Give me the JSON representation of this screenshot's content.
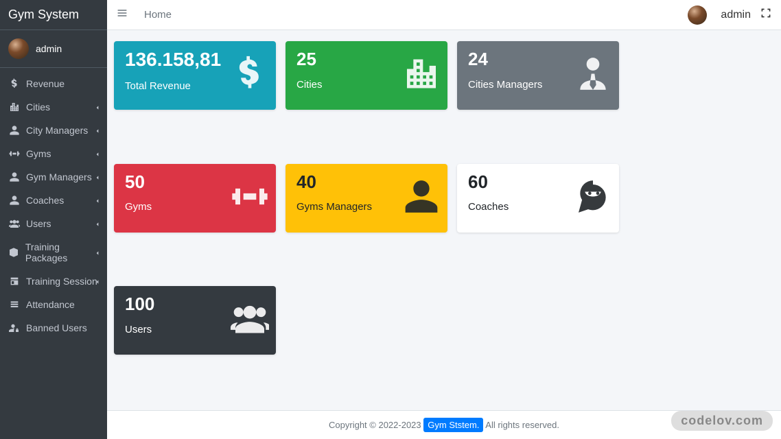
{
  "brand": "Gym System",
  "user": {
    "name": "admin"
  },
  "breadcrumb": "Home",
  "sidebar": {
    "items": [
      {
        "label": "Revenue",
        "icon": "dollar",
        "expandable": false
      },
      {
        "label": "Cities",
        "icon": "city",
        "expandable": true
      },
      {
        "label": "City Managers",
        "icon": "user",
        "expandable": true
      },
      {
        "label": "Gyms",
        "icon": "dumbbell",
        "expandable": true
      },
      {
        "label": "Gym Managers",
        "icon": "user",
        "expandable": true
      },
      {
        "label": "Coaches",
        "icon": "user",
        "expandable": true
      },
      {
        "label": "Users",
        "icon": "users",
        "expandable": true
      },
      {
        "label": "Training Packages",
        "icon": "package",
        "expandable": true
      },
      {
        "label": "Training Session",
        "icon": "session",
        "expandable": true
      },
      {
        "label": "Attendance",
        "icon": "list",
        "expandable": false
      },
      {
        "label": "Banned Users",
        "icon": "userlock",
        "expandable": false
      }
    ]
  },
  "cards": [
    {
      "value": "136.158,81",
      "label": "Total Revenue",
      "color": "#17a2b8",
      "icon": "dollar",
      "text": "#fff"
    },
    {
      "value": "25",
      "label": "Cities",
      "color": "#28a745",
      "icon": "city",
      "text": "#fff"
    },
    {
      "value": "24",
      "label": "Cities Managers",
      "color": "#6c757d",
      "icon": "usertie",
      "text": "#fff"
    },
    {
      "value": "50",
      "label": "Gyms",
      "color": "#dc3545",
      "icon": "dumbbell",
      "text": "#fff"
    },
    {
      "value": "40",
      "label": "Gyms Managers",
      "color": "#ffc107",
      "icon": "user",
      "text": "#212529"
    },
    {
      "value": "60",
      "label": "Coaches",
      "color": "#ffffff",
      "icon": "ninja",
      "text": "#212529"
    },
    {
      "value": "100",
      "label": "Users",
      "color": "#343a40",
      "icon": "users",
      "text": "#fff"
    }
  ],
  "footer": {
    "copyright": "Copyright © 2022-2023",
    "link": "Gym Ststem.",
    "rights": "All rights reserved."
  },
  "watermark": "codelov.com"
}
